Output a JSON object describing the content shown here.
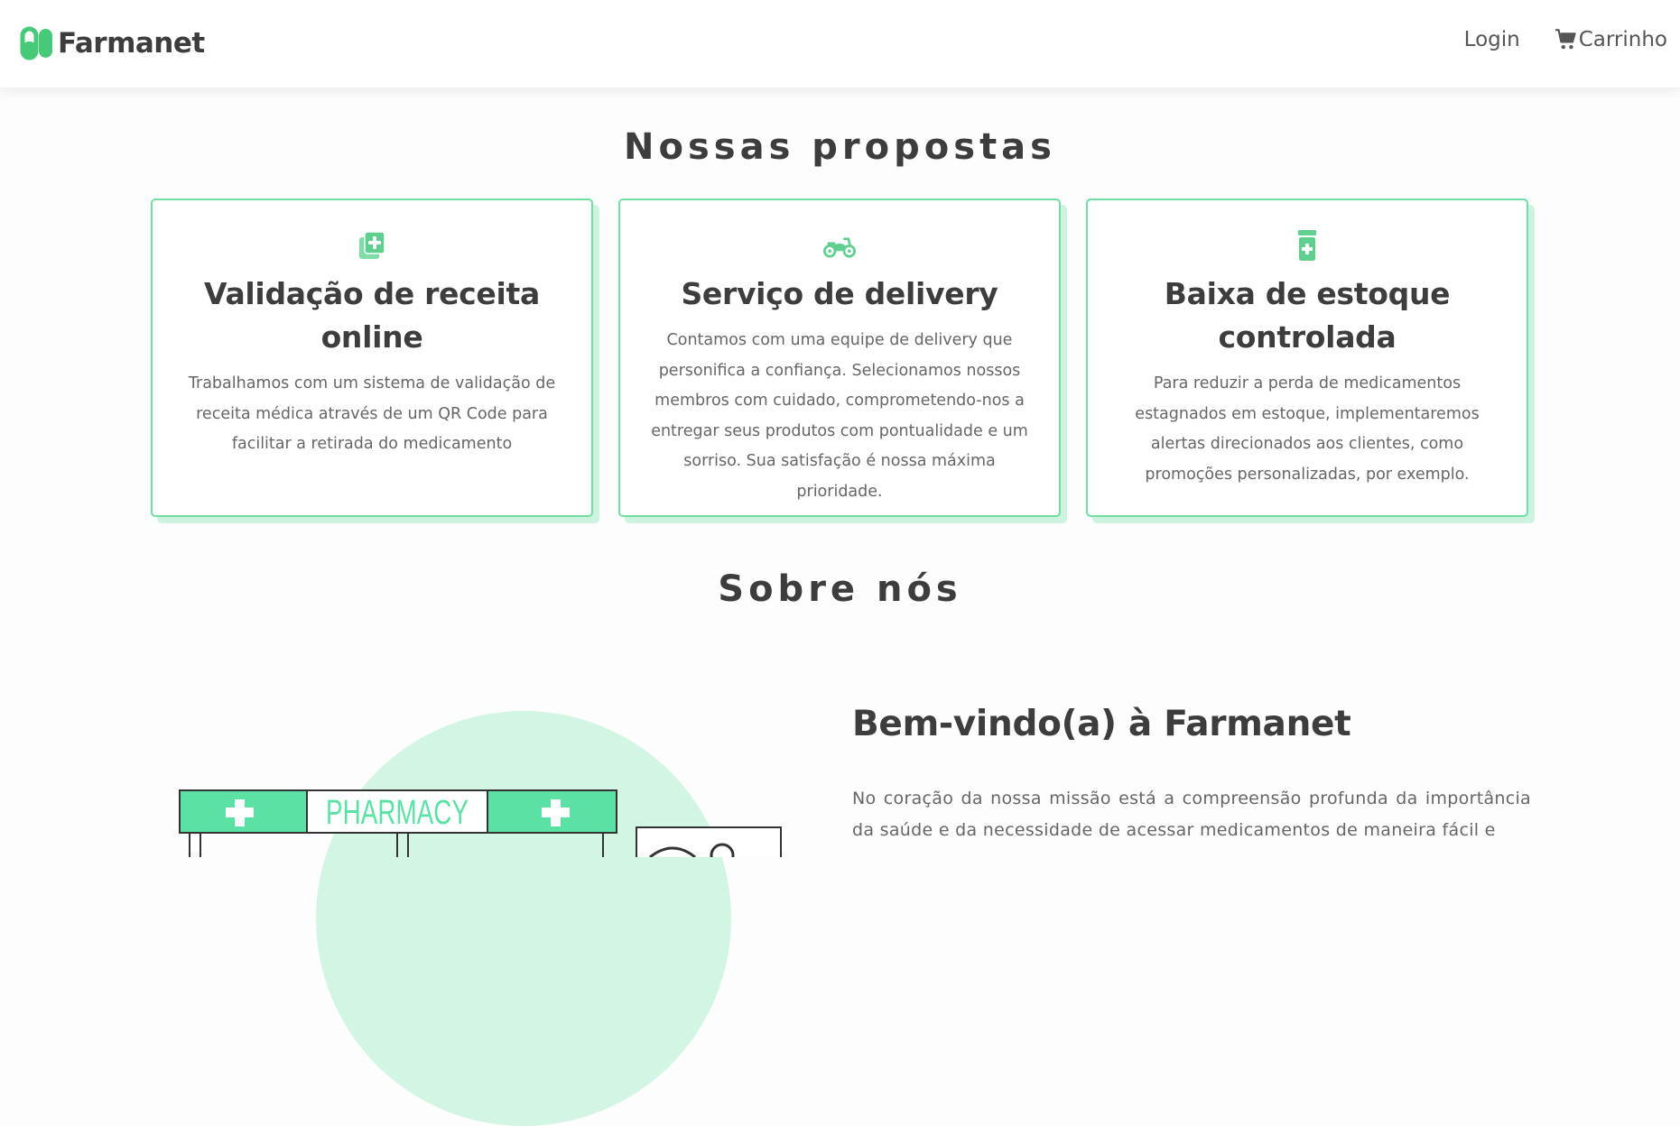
{
  "nav": {
    "brand": "Farmanet",
    "login": "Login",
    "cart": "Carrinho"
  },
  "proposals": {
    "title": "Nossas propostas",
    "cards": [
      {
        "icon": "prescription-plus-icon",
        "title": "Validação de receita online",
        "desc": "Trabalhamos com um sistema de validação de receita médica através de um QR Code para facilitar a retirada do medicamento"
      },
      {
        "icon": "motorcycle-icon",
        "title": "Serviço de delivery",
        "desc": "Contamos com uma equipe de delivery que personifica a confiança. Selecionamos nossos membros com cuidado, comprometendo-nos a entregar seus produtos com pontualidade e um sorriso. Sua satisfação é nossa máxima prioridade."
      },
      {
        "icon": "pill-bottle-icon",
        "title": "Baixa de estoque controlada",
        "desc": "Para reduzir a perda de medicamentos estagnados em estoque, implementaremos alertas direcionados aos clientes, como promoções personalizadas, por exemplo."
      }
    ]
  },
  "about": {
    "title": "Sobre nós",
    "welcome_title": "Bem-vindo(a) à Farmanet",
    "welcome_text": "No coração da nossa missão está a compreensão profunda da importância da saúde e da necessidade de acessar medicamentos de maneira fácil e",
    "illustration_sign": "PHARMACY"
  },
  "colors": {
    "accent": "#5ce1a4",
    "accent_light": "#d3f5e3",
    "text_dark": "#3d3d3d",
    "text_muted": "#666666"
  }
}
